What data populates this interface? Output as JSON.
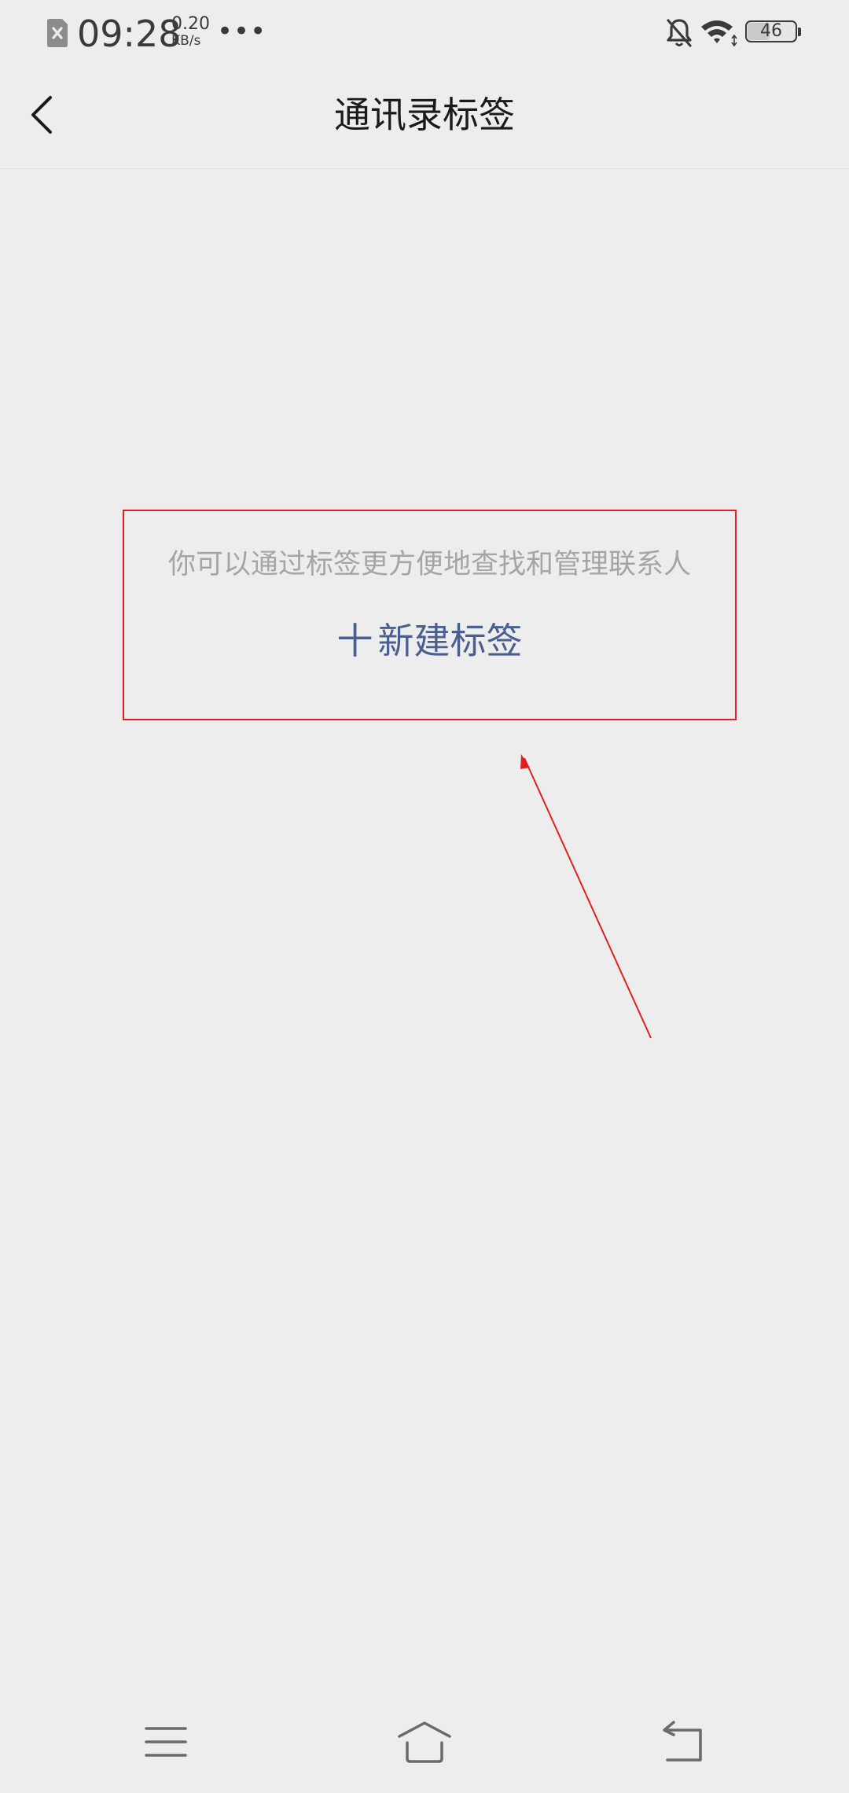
{
  "status_bar": {
    "time": "09:28",
    "net_speed_value": "0.20",
    "net_speed_unit": "KB/s",
    "more_indicator": "•••",
    "battery_level": "46",
    "battery_fraction": 0.46,
    "icons": [
      "sim-off-icon",
      "bell-off-icon",
      "wifi-icon",
      "battery-icon"
    ]
  },
  "header": {
    "title": "通讯录标签",
    "back_icon": "chevron-left-icon"
  },
  "empty_state": {
    "hint": "你可以通过标签更方便地查找和管理联系人",
    "plus": "十",
    "new_tag_label": "新建标签"
  },
  "nav_bar": {
    "icons": [
      "menu-icon",
      "home-icon",
      "back-icon"
    ]
  },
  "colors": {
    "background": "#ededed",
    "title": "#1a1a1a",
    "hint": "#a5a5a5",
    "accent": "#4b5f8f",
    "annotation": "#e02020"
  }
}
